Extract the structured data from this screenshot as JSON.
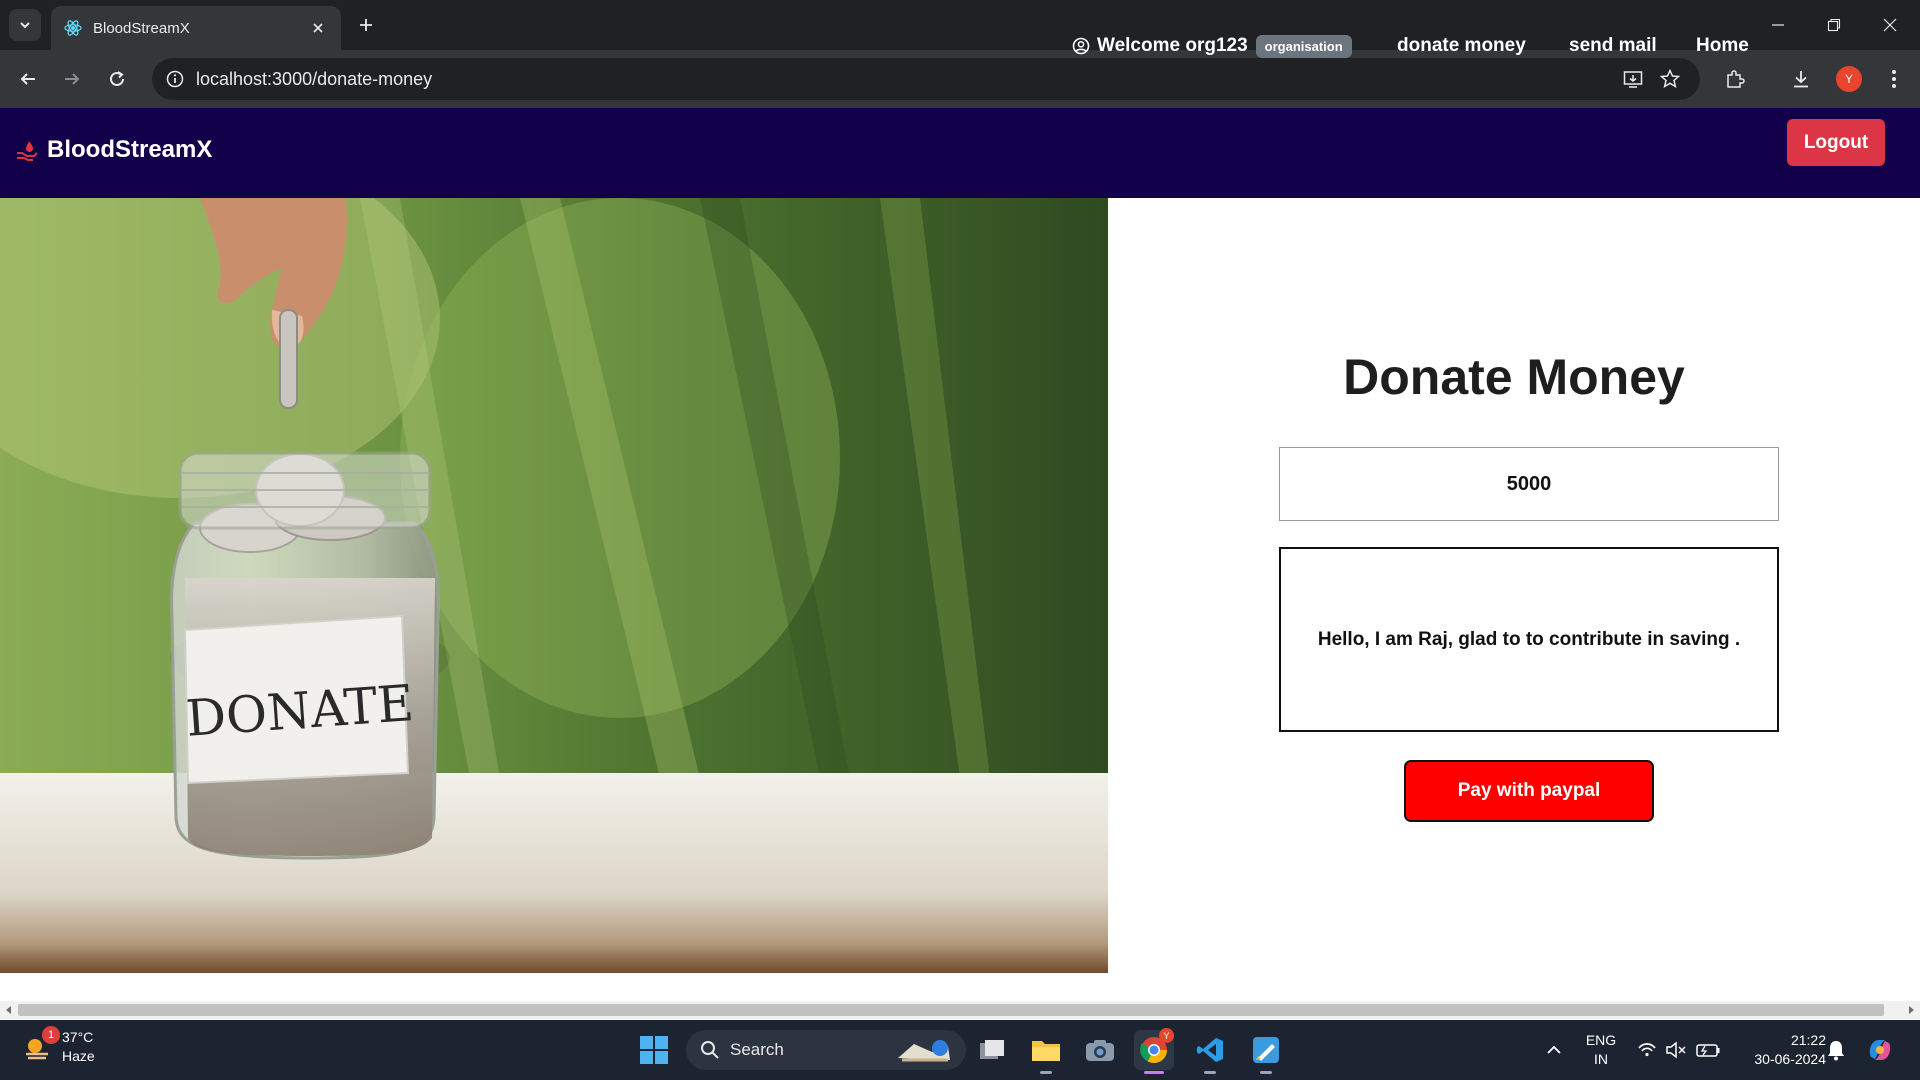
{
  "browser": {
    "tab_title": "BloodStreamX",
    "url": "localhost:3000/donate-money",
    "profile_initial": "Y"
  },
  "navbar": {
    "brand": "BloodStreamX",
    "welcome": "Welcome org123",
    "role_badge": "organisation",
    "links": {
      "donate_money": "donate money",
      "send_mail": "send mail",
      "home": "Home"
    },
    "logout": "Logout"
  },
  "hero": {
    "jar_label": "DONATE"
  },
  "form": {
    "title": "Donate Money",
    "amount_value": "5000",
    "message": "Hello, I am Raj, glad to to contribute in saving .",
    "pay_button": "Pay with paypal"
  },
  "taskbar": {
    "weather_temp": "37°C",
    "weather_desc": "Haze",
    "weather_alerts": "1",
    "search_label": "Search",
    "language_line1": "ENG",
    "language_line2": "IN",
    "time": "21:22",
    "date": "30-06-2024"
  }
}
